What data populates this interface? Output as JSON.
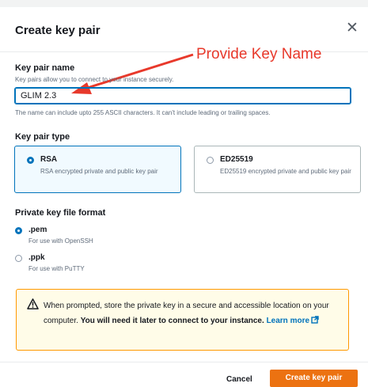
{
  "dialog": {
    "title": "Create key pair",
    "close_icon": "close-icon"
  },
  "annotation": {
    "text": "Provide Key Name",
    "color": "#e8392b"
  },
  "key_name": {
    "label": "Key pair name",
    "description": "Key pairs allow you to connect to your instance securely.",
    "value": "GLIM 2.3",
    "constraint": "The name can include upto 255 ASCII characters. It can't include leading or trailing spaces."
  },
  "key_type": {
    "label": "Key pair type",
    "options": [
      {
        "title": "RSA",
        "description": "RSA encrypted private and public key pair",
        "selected": true
      },
      {
        "title": "ED25519",
        "description": "ED25519 encrypted private and public key pair",
        "selected": false
      }
    ]
  },
  "file_format": {
    "label": "Private key file format",
    "options": [
      {
        "title": ".pem",
        "description": "For use with OpenSSH",
        "selected": true
      },
      {
        "title": ".ppk",
        "description": "For use with PuTTY",
        "selected": false
      }
    ]
  },
  "alert": {
    "icon": "warning-icon",
    "text_plain": "When prompted, store the private key in a secure and accessible location on your computer. ",
    "text_bold": "You will need it later to connect to your instance.",
    "link": "Learn more",
    "link_icon": "external-link-icon"
  },
  "footer": {
    "cancel_label": "Cancel",
    "create_label": "Create key pair"
  },
  "colors": {
    "primary": "#ec7211",
    "accent": "#0073bb",
    "warning": "#ff9900"
  }
}
